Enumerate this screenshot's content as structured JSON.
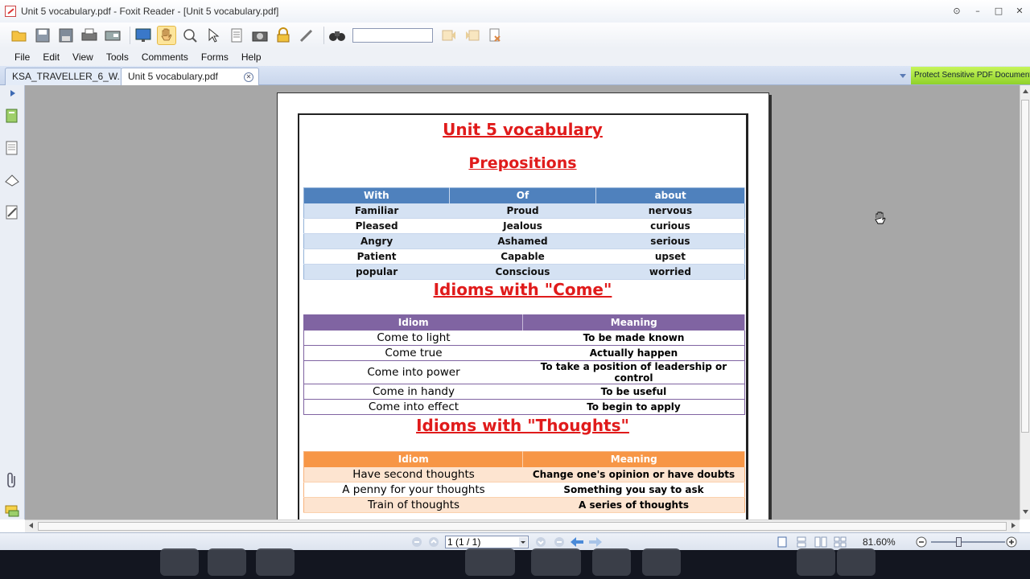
{
  "window": {
    "title": "Unit 5 vocabulary.pdf - Foxit Reader - [Unit 5 vocabulary.pdf]"
  },
  "toolbar": {
    "icons": [
      "open-icon",
      "save-icon",
      "save-as-icon",
      "print-icon",
      "print-preview-icon",
      "fullscreen-icon",
      "hand-tool-icon",
      "zoom-icon",
      "select-arrow-icon",
      "text-select-icon",
      "snapshot-icon",
      "rms-icon",
      "tool-icon",
      "find-binoculars-icon",
      "find-prev-icon",
      "find-next-icon",
      "find-options-icon"
    ],
    "find_value": ""
  },
  "menu": {
    "items": [
      "File",
      "Edit",
      "View",
      "Tools",
      "Comments",
      "Forms",
      "Help"
    ]
  },
  "tabs": [
    {
      "label": "KSA_TRAVELLER_6_W..."
    },
    {
      "label": "Unit 5 vocabulary.pdf"
    }
  ],
  "promo": {
    "label": "Protect Sensitive PDF Documents"
  },
  "status": {
    "page_value": "1 (1 / 1)",
    "zoom": "81.60%"
  },
  "document": {
    "title": "Unit 5 vocabulary",
    "prepositions": {
      "heading": "Prepositions",
      "headers": [
        "With",
        "Of",
        "about"
      ],
      "rows": [
        [
          "Familiar",
          "Proud",
          "nervous"
        ],
        [
          "Pleased",
          "Jealous",
          "curious"
        ],
        [
          "Angry",
          "Ashamed",
          "serious"
        ],
        [
          "Patient",
          "Capable",
          "upset"
        ],
        [
          "popular",
          "Conscious",
          "worried"
        ]
      ]
    },
    "come": {
      "heading": "Idioms with \"Come\"",
      "headers": [
        "Idiom",
        "Meaning"
      ],
      "rows": [
        [
          "Come to light",
          "To be made known"
        ],
        [
          "Come true",
          "Actually happen"
        ],
        [
          "Come into power",
          "To take a position of leadership or control"
        ],
        [
          "Come in handy",
          "To be useful"
        ],
        [
          "Come into effect",
          "To begin to apply"
        ]
      ]
    },
    "thoughts": {
      "heading": "Idioms with \"Thoughts\"",
      "headers": [
        "Idiom",
        "Meaning"
      ],
      "rows": [
        [
          "Have second thoughts",
          "Change one's opinion or have doubts"
        ],
        [
          "A penny for your thoughts",
          "Something you say to ask"
        ],
        [
          "Train of thoughts",
          "A series of thoughts"
        ]
      ]
    }
  },
  "colors": {
    "title_red": "#e01b1b",
    "blue_header": "#4f81bd",
    "purple_header": "#8064a2",
    "orange_header": "#f79646",
    "workspace": "#a7a7a7"
  }
}
